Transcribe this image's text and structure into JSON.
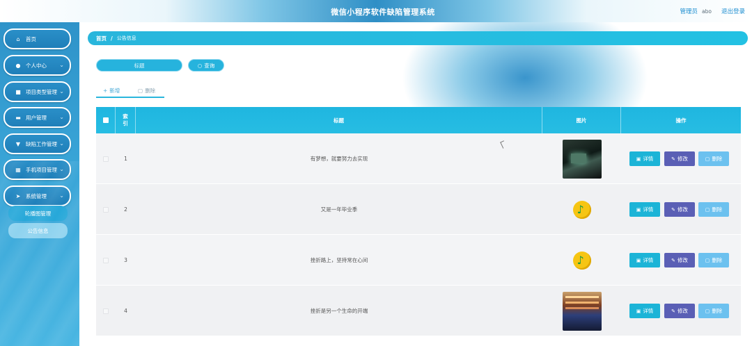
{
  "header": {
    "title": "微信小程序软件缺陷管理系统",
    "user_role": "管理员",
    "user_name": "abo",
    "logout": "退出登录"
  },
  "sidebar": {
    "items": [
      {
        "label": "首页",
        "icon": "home-icon",
        "has_chevron": false
      },
      {
        "label": "个人中心",
        "icon": "user-icon",
        "has_chevron": true
      },
      {
        "label": "项目类型管理",
        "icon": "list-icon",
        "has_chevron": true
      },
      {
        "label": "用户管理",
        "icon": "user-group-icon",
        "has_chevron": true
      },
      {
        "label": "缺陷工作管理",
        "icon": "filter-icon",
        "has_chevron": true
      },
      {
        "label": "手机项目管理",
        "icon": "grid-icon",
        "has_chevron": true
      },
      {
        "label": "系统管理",
        "icon": "send-icon",
        "has_chevron": true
      }
    ],
    "submenu": [
      {
        "label": "轮播图管理"
      },
      {
        "label": "公告信息"
      }
    ]
  },
  "breadcrumb": {
    "home": "首页",
    "separator": "/",
    "current": "公告信息"
  },
  "search": {
    "placeholder": "标题",
    "button_label": "查询"
  },
  "actions": {
    "add_label": "新增",
    "delete_label": "删除"
  },
  "table": {
    "columns": [
      "索引",
      "标题",
      "图片",
      "操作"
    ],
    "rows": [
      {
        "index": "1",
        "title": "有梦想，就要努力去实现",
        "image": "dark-screen"
      },
      {
        "index": "2",
        "title": "又是一年毕业季",
        "image": "qq-music"
      },
      {
        "index": "3",
        "title": "挫折路上，坚持常在心间",
        "image": "qq-music"
      },
      {
        "index": "4",
        "title": "挫折是另一个生命的开端",
        "image": "shop-photo"
      }
    ],
    "row_buttons": {
      "detail": "详情",
      "edit": "修改",
      "remove": "删除"
    }
  },
  "colors": {
    "accent": "#29b6dc",
    "sidebar": "#2f93c9",
    "edit_button": "#5a5fb5",
    "delete_button": "#6cc1ef"
  }
}
